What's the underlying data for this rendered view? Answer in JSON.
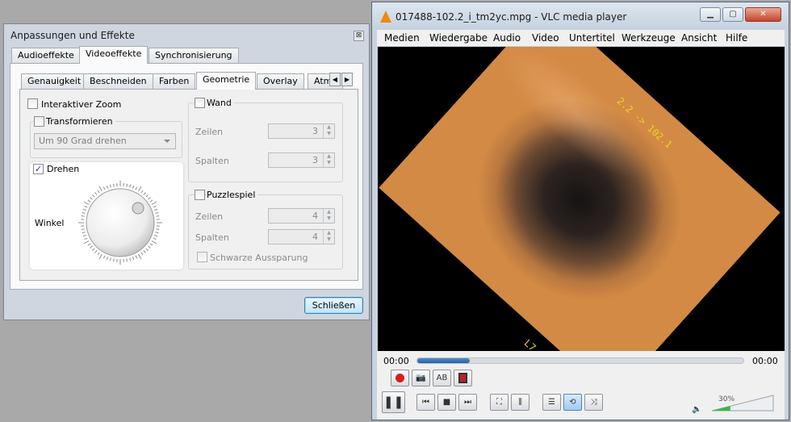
{
  "effects_dialog": {
    "title": "Anpassungen und Effekte",
    "close_glyph": "⊠",
    "main_tabs": [
      "Audioeffekte",
      "Videoeffekte",
      "Synchronisierung"
    ],
    "sub_tabs": [
      "Genauigkeit",
      "Beschneiden",
      "Farben",
      "Geometrie",
      "Overlay",
      "Atm"
    ],
    "interactive_zoom": "Interaktiver Zoom",
    "transform": "Transformieren",
    "transform_option": "Um 90 Grad drehen",
    "rotate": "Drehen",
    "angle": "Winkel",
    "wall": "Wand",
    "rows": "Zeilen",
    "columns": "Spalten",
    "wall_rows": "3",
    "wall_columns": "3",
    "puzzle": "Puzzlespiel",
    "puzzle_rows": "4",
    "puzzle_columns": "4",
    "black_slot": "Schwarze Aussparung",
    "close_button": "Schließen"
  },
  "vlc": {
    "title": "017488-102.2_i_tm2yc.mpg - VLC media player",
    "menu": [
      "Medien",
      "Wiedergabe",
      "Audio",
      "Video",
      "Untertitel",
      "Werkzeuge",
      "Ansicht",
      "Hilfe"
    ],
    "osd_top": "2.2 -> 102.1",
    "osd_bottom": "L7",
    "time_elapsed": "00:00",
    "time_total": "00:00",
    "seek_fraction": 0.16,
    "volume_percent": "30%",
    "volume_fraction": 0.3,
    "accent": "#2c6ab2"
  }
}
